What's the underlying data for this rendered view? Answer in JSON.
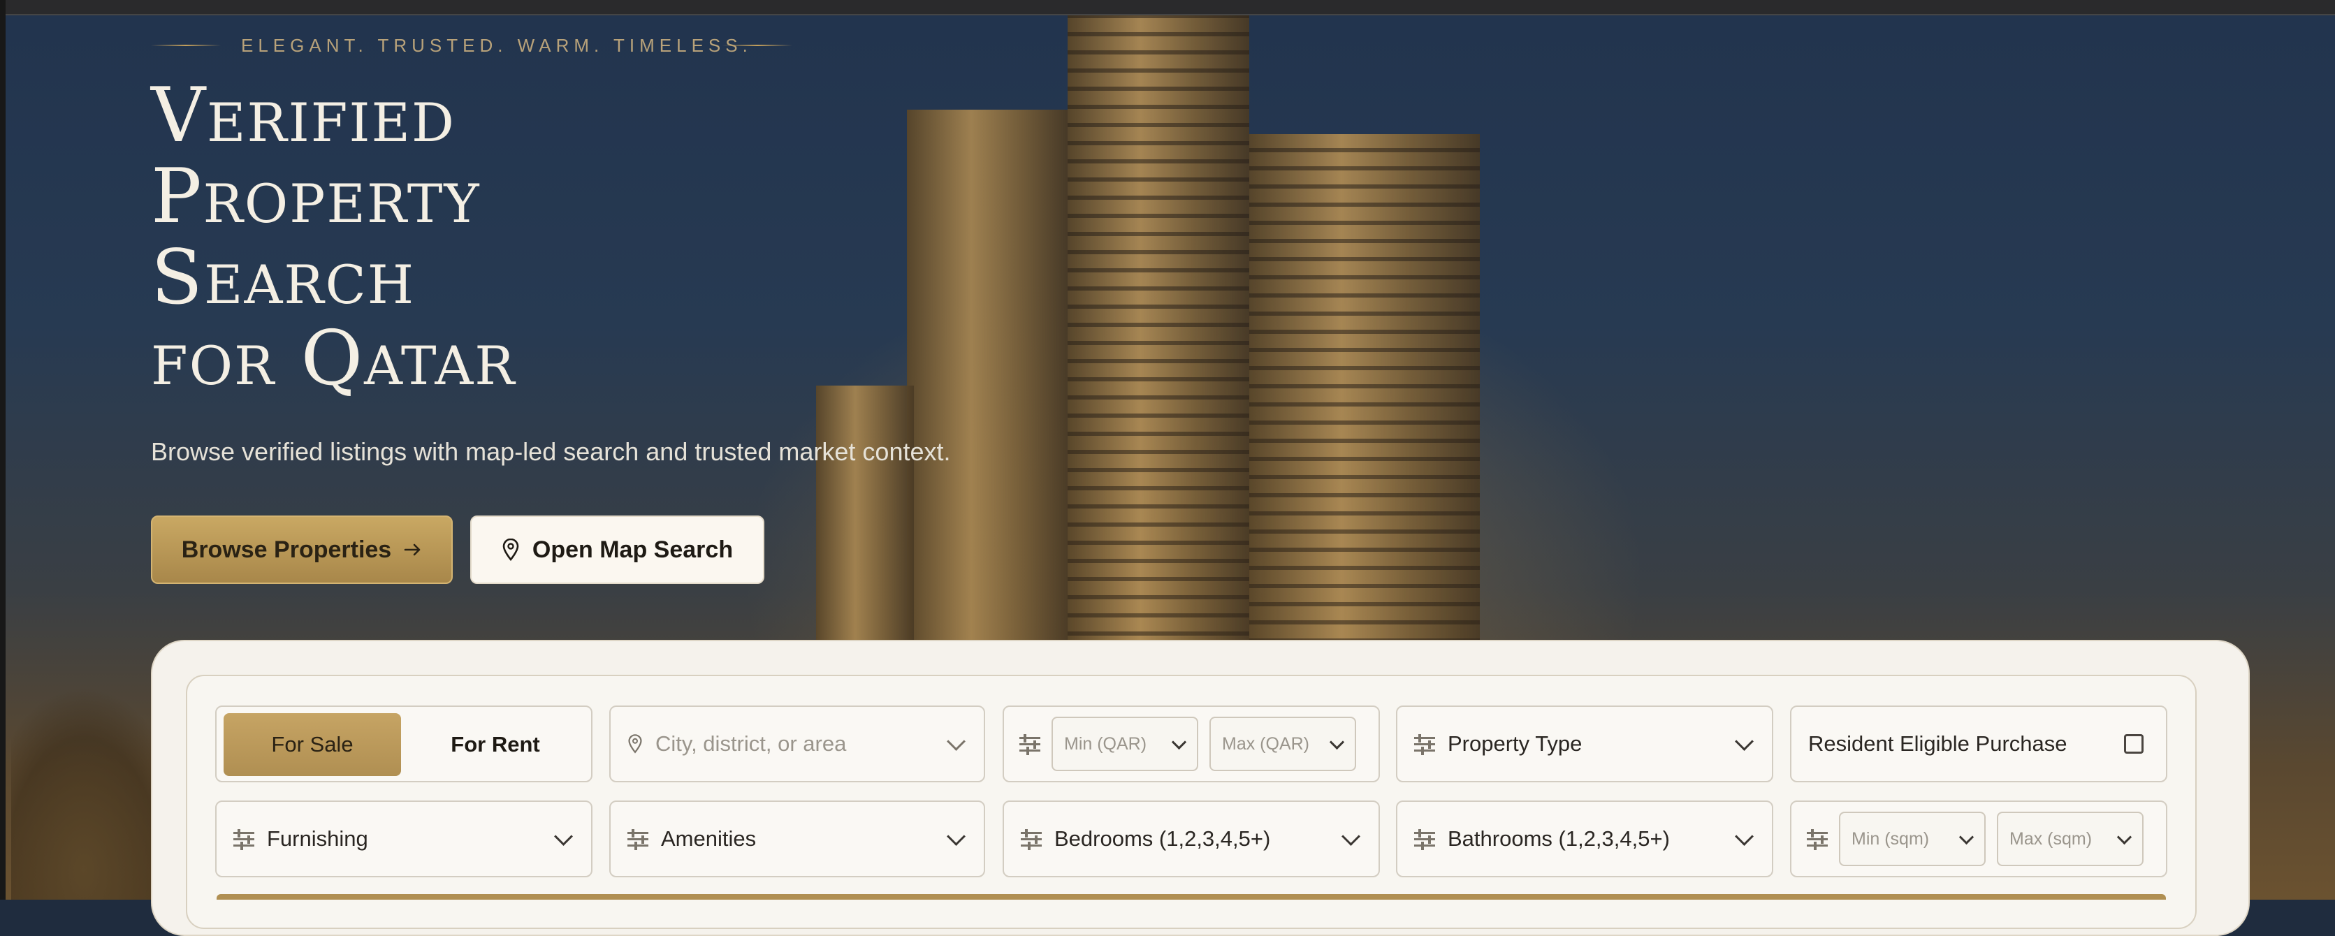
{
  "hero": {
    "eyebrow": "ELEGANT. TRUSTED. WARM. TIMELESS.",
    "title_lines": [
      "Verified",
      "Property",
      "Search",
      "for Qatar"
    ],
    "subtitle": "Browse verified listings with map-led search and trusted market context.",
    "browse_button": "Browse Properties",
    "map_button": "Open Map Search"
  },
  "search": {
    "listing_type": {
      "options": [
        "For Sale",
        "For Rent"
      ],
      "selected": "For Sale"
    },
    "location_placeholder": "City, district, or area",
    "price_min_placeholder": "Min (QAR)",
    "price_max_placeholder": "Max (QAR)",
    "property_type": "Property Type",
    "resident_eligible": {
      "label": "Resident Eligible Purchase",
      "checked": false
    },
    "furnishing": "Furnishing",
    "amenities": "Amenities",
    "bedrooms": "Bedrooms (1,2,3,4,5+)",
    "bathrooms": "Bathrooms (1,2,3,4,5+)",
    "area_min_placeholder": "Min (sqm)",
    "area_max_placeholder": "Max (sqm)"
  },
  "icons": {
    "location": "map-pin-icon",
    "filter": "sliders-icon",
    "dropdown": "chevron-down-icon",
    "arrow": "arrow-right-icon"
  },
  "colors": {
    "accent_gold": "#c4a05c",
    "panel_bg": "#f5f2ec",
    "text_light": "#f4efe4"
  }
}
